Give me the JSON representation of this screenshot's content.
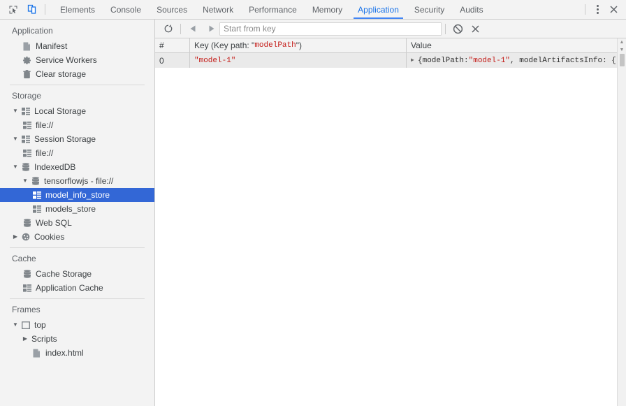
{
  "titlebar": {
    "inspect_icon": "inspect-element-icon",
    "device_icon": "device-toolbar-icon",
    "menu_icon": "more-options-icon",
    "close_icon": "close-icon",
    "tabs": [
      {
        "label": "Elements",
        "active": false
      },
      {
        "label": "Console",
        "active": false
      },
      {
        "label": "Sources",
        "active": false
      },
      {
        "label": "Network",
        "active": false
      },
      {
        "label": "Performance",
        "active": false
      },
      {
        "label": "Memory",
        "active": false
      },
      {
        "label": "Application",
        "active": true
      },
      {
        "label": "Security",
        "active": false
      },
      {
        "label": "Audits",
        "active": false
      }
    ]
  },
  "sidebar": {
    "sections": [
      {
        "title": "Application",
        "items": [
          {
            "label": "Manifest",
            "icon": "page-icon",
            "indent": 1,
            "twisty": "",
            "selected": false
          },
          {
            "label": "Service Workers",
            "icon": "gear-icon",
            "indent": 1,
            "twisty": "",
            "selected": false
          },
          {
            "label": "Clear storage",
            "icon": "trash-icon",
            "indent": 1,
            "twisty": "",
            "selected": false
          }
        ]
      },
      {
        "title": "Storage",
        "items": [
          {
            "label": "Local Storage",
            "icon": "table-icon",
            "indent": 0,
            "twisty": "down",
            "selected": false
          },
          {
            "label": "file://",
            "icon": "table-icon",
            "indent": 1,
            "twisty": "",
            "selected": false
          },
          {
            "label": "Session Storage",
            "icon": "table-icon",
            "indent": 0,
            "twisty": "down",
            "selected": false
          },
          {
            "label": "file://",
            "icon": "table-icon",
            "indent": 1,
            "twisty": "",
            "selected": false
          },
          {
            "label": "IndexedDB",
            "icon": "database-icon",
            "indent": 0,
            "twisty": "down",
            "selected": false
          },
          {
            "label": "tensorflowjs - file://",
            "icon": "database-icon",
            "indent": 1,
            "twisty": "down",
            "selected": false
          },
          {
            "label": "model_info_store",
            "icon": "table-icon",
            "indent": 2,
            "twisty": "",
            "selected": true
          },
          {
            "label": "models_store",
            "icon": "table-icon",
            "indent": 2,
            "twisty": "",
            "selected": false
          },
          {
            "label": "Web SQL",
            "icon": "database-icon",
            "indent": 0,
            "twisty": "",
            "selected": false
          },
          {
            "label": "Cookies",
            "icon": "cookie-icon",
            "indent": 0,
            "twisty": "right",
            "selected": false
          }
        ]
      },
      {
        "title": "Cache",
        "items": [
          {
            "label": "Cache Storage",
            "icon": "database-icon",
            "indent": 1,
            "twisty": "",
            "selected": false
          },
          {
            "label": "Application Cache",
            "icon": "table-icon",
            "indent": 1,
            "twisty": "",
            "selected": false
          }
        ]
      },
      {
        "title": "Frames",
        "items": [
          {
            "label": "top",
            "icon": "frame-icon",
            "indent": 0,
            "twisty": "down",
            "selected": false
          },
          {
            "label": "Scripts",
            "icon": "",
            "indent": 1,
            "twisty": "right",
            "selected": false
          },
          {
            "label": "index.html",
            "icon": "page-icon",
            "indent": 2,
            "twisty": "",
            "selected": false
          }
        ]
      }
    ]
  },
  "main": {
    "toolbar": {
      "refresh_icon": "refresh-icon",
      "prev_icon": "previous-page-icon",
      "next_icon": "next-page-icon",
      "key_filter_placeholder": "Start from key",
      "key_filter_value": "",
      "clear_icon": "clear-object-store-icon",
      "delete_icon": "delete-selected-icon"
    },
    "grid": {
      "columns": [
        {
          "id": "num",
          "label": "#"
        },
        {
          "id": "key",
          "label_prefix": "Key (Key path: \"",
          "label_keypath": "modelPath",
          "label_suffix": "\")"
        },
        {
          "id": "value",
          "label": "Value"
        }
      ],
      "rows": [
        {
          "num": "0",
          "key": "\"model-1\"",
          "value_prefix": "{modelPath: ",
          "value_string": "\"model-1\"",
          "value_suffix": ", modelArtifactsInfo: {"
        }
      ]
    }
  },
  "colors": {
    "accent": "#4285f4",
    "selection": "#3367d6",
    "toolbar_bg": "#f3f3f3",
    "string_red": "#c41a16",
    "row_bg": "#eaeaea"
  }
}
